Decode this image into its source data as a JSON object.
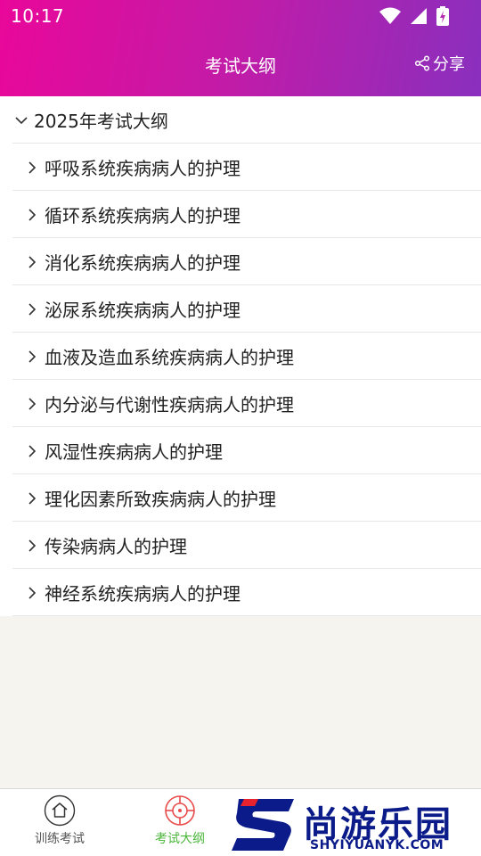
{
  "status_bar": {
    "time": "10:17",
    "icons": [
      "wifi-icon",
      "cell-signal-icon",
      "battery-charging-icon"
    ]
  },
  "header": {
    "title": "考试大纲",
    "share_label": "分享",
    "share_icon": "share-icon",
    "gradient": [
      "#e9079a",
      "#8a2fbe"
    ]
  },
  "outline": {
    "year_item": {
      "label": "2025年考试大纲",
      "expanded": true,
      "icon": "chevron-down-icon"
    },
    "chapters": [
      "呼吸系统疾病病人的护理",
      "循环系统疾病病人的护理",
      "消化系统疾病病人的护理",
      "泌尿系统疾病病人的护理",
      "血液及造血系统疾病病人的护理",
      "内分泌与代谢性疾病病人的护理",
      "风湿性疾病病人的护理",
      "理化因素所致疾病病人的护理",
      "传染病病人的护理",
      "神经系统疾病病人的护理"
    ]
  },
  "bottom_nav": {
    "tabs": [
      {
        "label": "训练考试",
        "icon": "home-icon",
        "active": false
      },
      {
        "label": "考试大纲",
        "icon": "target-icon",
        "active": true
      }
    ],
    "active_color": "#4ab63a",
    "accent_icon_color": "#e94b4b"
  },
  "watermark": {
    "name": "尚游乐园",
    "url": "SHYIYUANYK.COM",
    "color": "#0b1c8a"
  }
}
